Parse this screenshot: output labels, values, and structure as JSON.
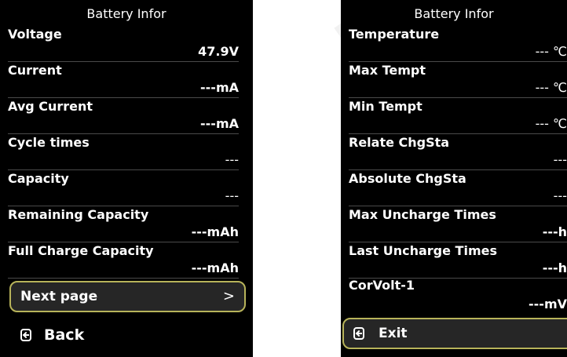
{
  "left": {
    "title": "Battery Infor",
    "rows": [
      {
        "label": "Voltage",
        "value": "47.9V"
      },
      {
        "label": "Current",
        "value": "---mA"
      },
      {
        "label": "Avg Current",
        "value": "---mA"
      },
      {
        "label": "Cycle times",
        "value": "---"
      },
      {
        "label": "Capacity",
        "value": "---"
      },
      {
        "label": "Remaining Capacity",
        "value": "---mAh"
      },
      {
        "label": "Full Charge Capacity",
        "value": "---mAh"
      }
    ],
    "next_label": "Next page",
    "next_chevron": ">",
    "back_label": "Back"
  },
  "right": {
    "title": "Battery Infor",
    "rows": [
      {
        "label": "Temperature",
        "value": "--- ℃"
      },
      {
        "label": "Max Tempt",
        "value": "--- ℃"
      },
      {
        "label": "Min Tempt",
        "value": "--- ℃"
      },
      {
        "label": "Relate ChgSta",
        "value": "---"
      },
      {
        "label": "Absolute ChgSta",
        "value": "---"
      },
      {
        "label": "Max Uncharge Times",
        "value": "---h"
      },
      {
        "label": "Last Uncharge Times",
        "value": "---h"
      },
      {
        "label": "CorVolt-1",
        "value": "---mV"
      }
    ],
    "exit_label": "Exit"
  },
  "colors": {
    "screen_bg": "#000000",
    "accent_border": "#b7b35a",
    "divider": "#4a4a4a"
  }
}
